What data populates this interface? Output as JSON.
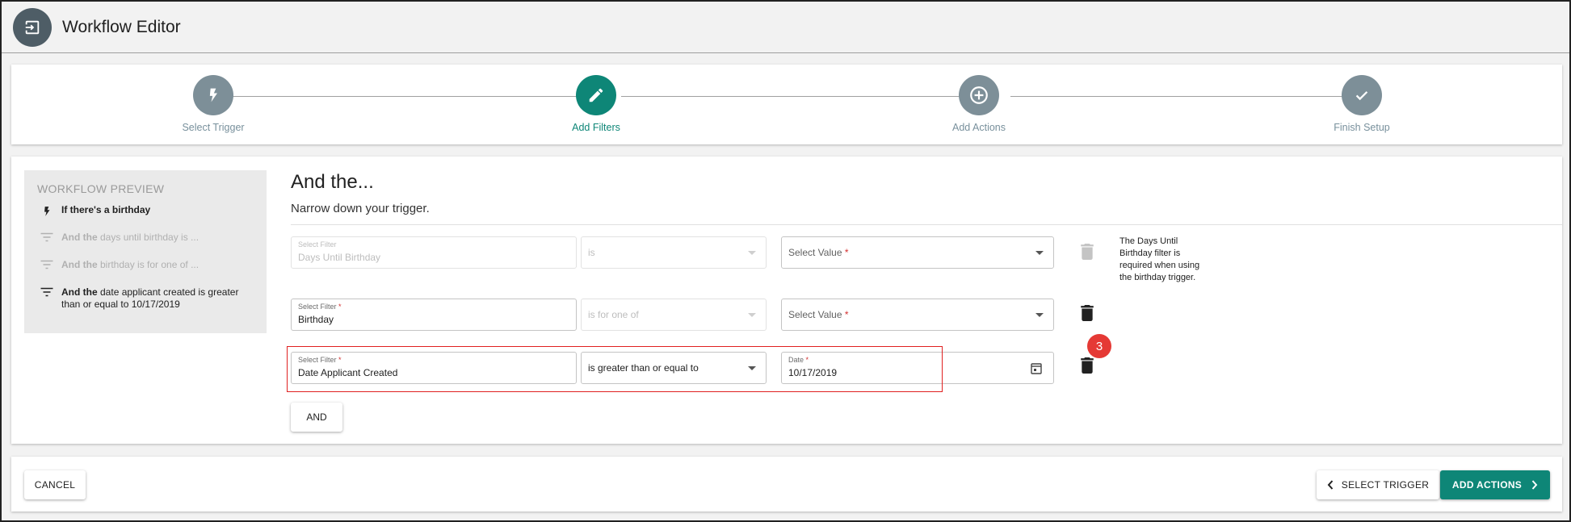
{
  "header": {
    "title": "Workflow Editor",
    "icon": "exit-to-app-icon"
  },
  "stepper": {
    "steps": [
      {
        "label": "Select Trigger",
        "icon": "bolt-icon",
        "active": false
      },
      {
        "label": "Add Filters",
        "icon": "pencil-icon",
        "active": true
      },
      {
        "label": "Add Actions",
        "icon": "add-circle-icon",
        "active": false
      },
      {
        "label": "Finish Setup",
        "icon": "check-icon",
        "active": false
      }
    ]
  },
  "preview": {
    "title": "WORKFLOW PREVIEW",
    "items": [
      {
        "bold": "If there's a birthday",
        "rest": ""
      },
      {
        "bold": "And the",
        "rest": " days until birthday is ..."
      },
      {
        "bold": "And the",
        "rest": " birthday is for one of ..."
      },
      {
        "bold": "And the",
        "rest": " date applicant created is greater than or equal to 10/17/2019"
      }
    ]
  },
  "filters": {
    "heading": "And the...",
    "subheading": "Narrow down your trigger.",
    "rows": [
      {
        "filter_label": "Select Filter",
        "filter_value": "Days Until Birthday",
        "operator_value": "is",
        "value_placeholder": "Select Value",
        "required": "*"
      },
      {
        "filter_label": "Select Filter",
        "filter_value": "Birthday",
        "operator_value": "is for one of",
        "value_placeholder": "Select Value",
        "required": "*"
      },
      {
        "filter_label": "Select Filter",
        "filter_value": "Date Applicant Created",
        "operator_value": "is greater than or equal to",
        "value_label": "Date",
        "value_value": "10/17/2019",
        "required": "*"
      }
    ],
    "help_text": "The Days Until Birthday filter is required when using the birthday trigger.",
    "badge": "3",
    "and_button": "AND"
  },
  "footer": {
    "cancel": "CANCEL",
    "back": "SELECT TRIGGER",
    "next": "ADD ACTIONS"
  },
  "colors": {
    "accent": "#0e8677",
    "step_inactive": "#7d8f98",
    "highlight": "#e02020",
    "badge": "#e53935"
  }
}
